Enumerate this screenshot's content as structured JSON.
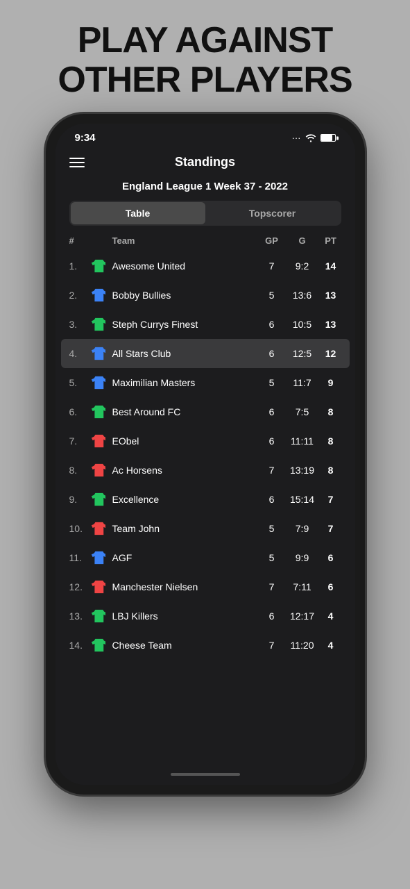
{
  "headline": {
    "line1": "PLAY AGAINST",
    "line2": "OTHER PLAYERS"
  },
  "status_bar": {
    "time": "9:34",
    "dots": "···",
    "wifi": "wifi",
    "battery": "battery"
  },
  "app": {
    "title": "Standings",
    "league": "England League 1 Week 37 - 2022",
    "tabs": [
      {
        "label": "Table",
        "active": true
      },
      {
        "label": "Topscorer",
        "active": false
      }
    ],
    "table_headers": {
      "rank": "#",
      "team": "Team",
      "gp": "GP",
      "g": "G",
      "pt": "PT"
    },
    "rows": [
      {
        "rank": "1.",
        "name": "Awesome United",
        "color": "green",
        "gp": "7",
        "g": "9:2",
        "pt": "14",
        "highlighted": false
      },
      {
        "rank": "2.",
        "name": "Bobby Bullies",
        "color": "blue",
        "gp": "5",
        "g": "13:6",
        "pt": "13",
        "highlighted": false
      },
      {
        "rank": "3.",
        "name": "Steph Currys Finest",
        "color": "green",
        "gp": "6",
        "g": "10:5",
        "pt": "13",
        "highlighted": false
      },
      {
        "rank": "4.",
        "name": "All Stars Club",
        "color": "blue",
        "gp": "6",
        "g": "12:5",
        "pt": "12",
        "highlighted": true
      },
      {
        "rank": "5.",
        "name": "Maximilian Masters",
        "color": "blue",
        "gp": "5",
        "g": "11:7",
        "pt": "9",
        "highlighted": false
      },
      {
        "rank": "6.",
        "name": "Best Around FC",
        "color": "green",
        "gp": "6",
        "g": "7:5",
        "pt": "8",
        "highlighted": false
      },
      {
        "rank": "7.",
        "name": "EObel",
        "color": "red",
        "gp": "6",
        "g": "11:11",
        "pt": "8",
        "highlighted": false
      },
      {
        "rank": "8.",
        "name": "Ac Horsens",
        "color": "red",
        "gp": "7",
        "g": "13:19",
        "pt": "8",
        "highlighted": false
      },
      {
        "rank": "9.",
        "name": "Excellence",
        "color": "green",
        "gp": "6",
        "g": "15:14",
        "pt": "7",
        "highlighted": false
      },
      {
        "rank": "10.",
        "name": "Team John",
        "color": "red",
        "gp": "5",
        "g": "7:9",
        "pt": "7",
        "highlighted": false
      },
      {
        "rank": "11.",
        "name": "AGF",
        "color": "blue",
        "gp": "5",
        "g": "9:9",
        "pt": "6",
        "highlighted": false
      },
      {
        "rank": "12.",
        "name": "Manchester Nielsen",
        "color": "red",
        "gp": "7",
        "g": "7:11",
        "pt": "6",
        "highlighted": false
      },
      {
        "rank": "13.",
        "name": "LBJ Killers",
        "color": "green",
        "gp": "6",
        "g": "12:17",
        "pt": "4",
        "highlighted": false
      },
      {
        "rank": "14.",
        "name": "Cheese Team",
        "color": "green",
        "gp": "7",
        "g": "11:20",
        "pt": "4",
        "highlighted": false
      }
    ]
  }
}
